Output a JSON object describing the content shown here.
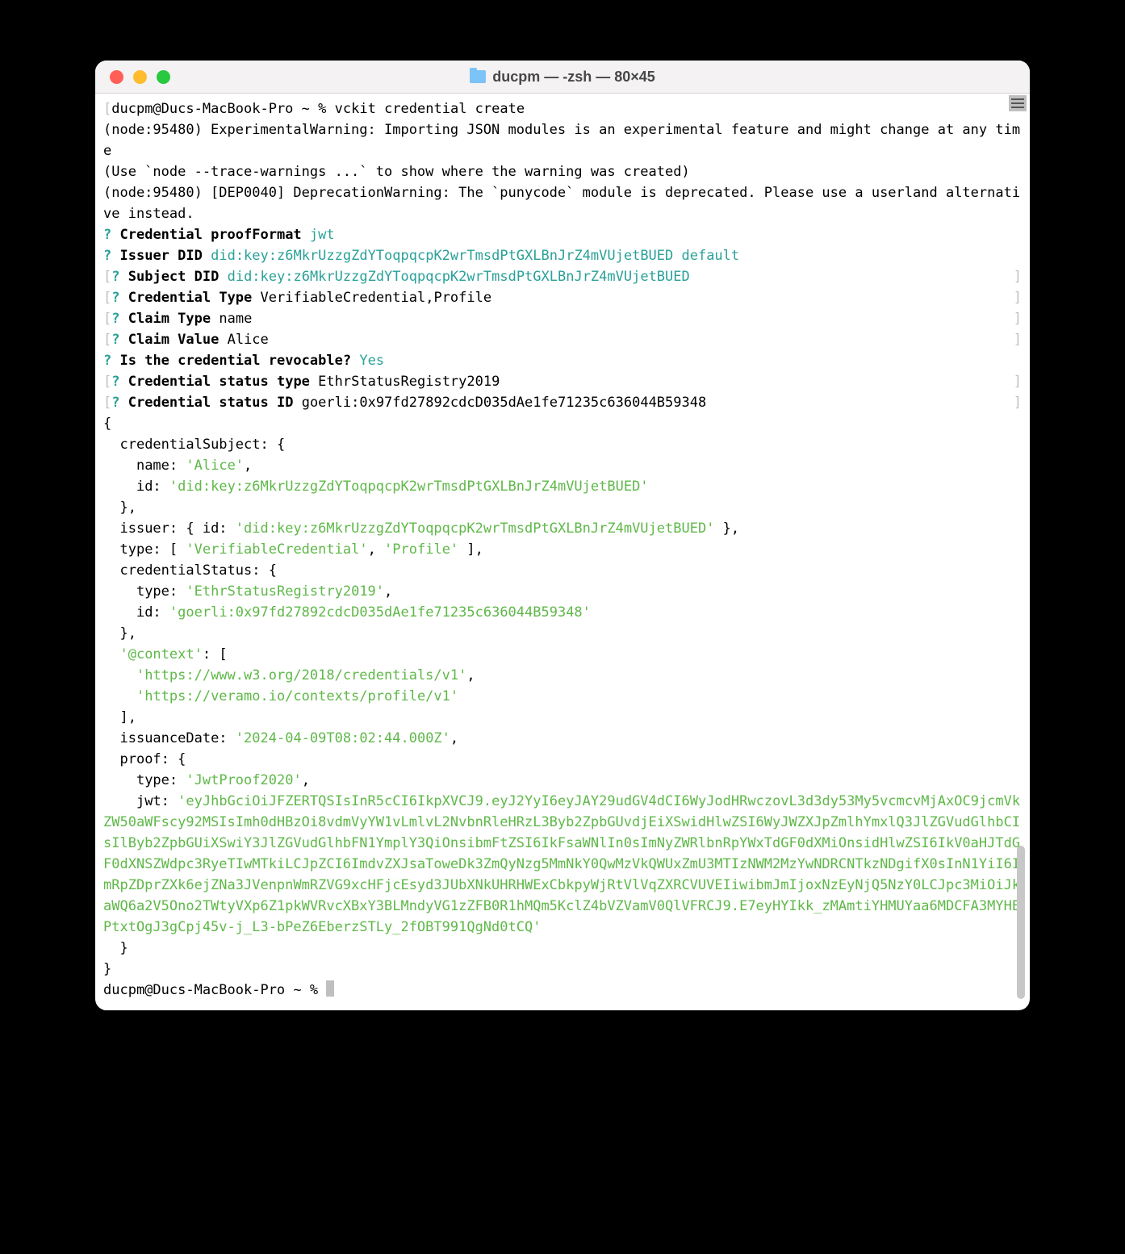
{
  "window": {
    "title": "ducpm — -zsh — 80×45"
  },
  "prompt": {
    "user_host": "ducpm@Ducs-MacBook-Pro",
    "path": "~",
    "symbol": "%",
    "command": "vckit credential create"
  },
  "warnings": {
    "line1": "(node:95480) ExperimentalWarning: Importing JSON modules is an experimental feature and might change at any time",
    "line2": "(Use `node --trace-warnings ...` to show where the warning was created)",
    "line3": "(node:95480) [DEP0040] DeprecationWarning: The `punycode` module is deprecated. Please use a userland alternative instead."
  },
  "qa": {
    "q_mark": "?",
    "proofFormat": {
      "label": "Credential proofFormat",
      "value": "jwt"
    },
    "issuerDID": {
      "label": "Issuer DID",
      "value": "did:key:z6MkrUzzgZdYToqpqcpK2wrTmsdPtGXLBnJrZ4mVUjetBUED default"
    },
    "subjectDID": {
      "label": "Subject DID",
      "value": "did:key:z6MkrUzzgZdYToqpqcpK2wrTmsdPtGXLBnJrZ4mVUjetBUED"
    },
    "credType": {
      "label": "Credential Type",
      "value": "VerifiableCredential,Profile"
    },
    "claimType": {
      "label": "Claim Type",
      "value": "name"
    },
    "claimValue": {
      "label": "Claim Value",
      "value": "Alice"
    },
    "revocable": {
      "label": "Is the credential revocable?",
      "value": "Yes"
    },
    "statusType": {
      "label": "Credential status type",
      "value": "EthrStatusRegistry2019"
    },
    "statusId": {
      "label": "Credential status ID",
      "value": "goerli:0x97fd27892cdcD035dAe1fe71235c636044B59348"
    }
  },
  "brackets": {
    "l": "[",
    "r": "]"
  },
  "json": {
    "subject_name": "'Alice'",
    "subject_id": "'did:key:z6MkrUzzgZdYToqpqcpK2wrTmsdPtGXLBnJrZ4mVUjetBUED'",
    "issuer_id": "'did:key:z6MkrUzzgZdYToqpqcpK2wrTmsdPtGXLBnJrZ4mVUjetBUED'",
    "type1": "'VerifiableCredential'",
    "type2": "'Profile'",
    "status_type": "'EthrStatusRegistry2019'",
    "status_id": "'goerli:0x97fd27892cdcD035dAe1fe71235c636044B59348'",
    "context_key": "'@context'",
    "ctx1": "'https://www.w3.org/2018/credentials/v1'",
    "ctx2": "'https://veramo.io/contexts/profile/v1'",
    "issuance": "'2024-04-09T08:02:44.000Z'",
    "proof_type": "'JwtProof2020'",
    "jwt": "'eyJhbGciOiJFZERTQSIsInR5cCI6IkpXVCJ9.eyJ2YyI6eyJAY29udGV4dCI6WyJodHRwczovL3d3dy53My5vcmcvMjAxOC9jcmVkZW50aWFscy92MSIsImh0dHBzOi8vdmVyYW1vLmlvL2NvbnRleHRzL3Byb2ZpbGUvdjEiXSwidHlwZSI6WyJWZXJpZmlhYmxlQ3JlZGVudGlhbCIsIlByb2ZpbGUiXSwiY3JlZGVudGlhbFN1YmplY3QiOnsibmFtZSI6IkFsaWNlIn0sImNyZWRlbnRpYWxTdGF0dXMiOnsidHlwZSI6IkV0aHJTdGF0dXNSZWdpc3RyeTIwMTkiLCJpZCI6ImdvZXJsaToweDk3ZmQyNzg5MmNkY0QwMzVkQWUxZmU3MTIzNWM2MzYwNDRCNTkzNDgifX0sInN1YiI6ImRpZDprZXk6ejZNa3JVenpnWmRZVG9xcHFjcEsyd3JUbXNkUHRHWExCbkpyWjRtVlVqZXRCVUVEIiwibmJmIjoxNzEyNjQ5NzY0LCJpc3MiOiJkaWQ6a2V5Ono2TWtyVXp6Z1pkWVRvcXBxY3BLMndyVG1zZFB0R1hMQm5KclZ4bVZVamV0QlVFRCJ9.E7eyHYIkk_zMAmtiYHMUYaa6MDCFA3MYHEPtxtOgJ3gCpj45v-j_L3-bPeZ6EberzSTLy_2fOBT991QgNd0tCQ'"
  },
  "labels": {
    "credentialSubject": "credentialSubject: {",
    "name_k": "name:",
    "id_k": "id:",
    "close_comma": "},",
    "issuer_open": "issuer: { id:",
    "issuer_close": " },",
    "type_open": "type: [",
    "type_close": " ],",
    "credStatus_open": "credentialStatus: {",
    "type_k": "type:",
    "ctx_open": ": [",
    "close_bracket_comma": "],",
    "issuanceDate_k": "issuanceDate:",
    "proof_open": "proof: {",
    "jwt_k": "jwt:",
    "close_brace": "}",
    "open_brace": "{",
    "comma": ","
  }
}
